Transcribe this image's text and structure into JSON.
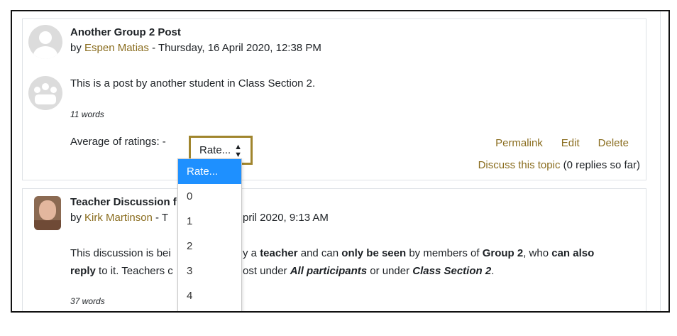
{
  "post1": {
    "title": "Another Group 2 Post",
    "by_prefix": "by ",
    "author": "Espen Matias",
    "date": " - Thursday, 16 April 2020, 12:38 PM",
    "body": "This is a post by another student in Class Section 2.",
    "words": "11 words",
    "avg_label": "Average of ratings: -",
    "rate_selected": "Rate...",
    "actions": [
      "Permalink",
      "Edit",
      "Delete"
    ],
    "discuss_link": "Discuss this topic",
    "discuss_suffix": "(0 replies so far)"
  },
  "dropdown": {
    "options": [
      "Rate...",
      "0",
      "1",
      "2",
      "3",
      "4"
    ],
    "selected_index": 0,
    "highlight_color": "#1e90ff"
  },
  "post2": {
    "title": "Teacher Discussion f",
    "by_prefix": "by ",
    "author": "Kirk Martinson",
    "date_left": " - T",
    "date_right": "pril 2020, 9:13 AM",
    "line1_a": "This discussion is bei",
    "line1_b": "y a ",
    "line1_teacher": "teacher",
    "line1_c": " and can ",
    "line1_only": "only be seen",
    "line1_d": " by members of ",
    "line1_group": "Group 2",
    "line1_e": ", who ",
    "line1_can": "can also",
    "line2_reply": "reply",
    "line2_a": " to it. Teachers c",
    "line2_b": "ost under ",
    "line2_all": "All participants",
    "line2_c": " or under ",
    "line2_section": "Class Section 2",
    "line2_d": ".",
    "words": "37 words"
  },
  "colors": {
    "link": "#8a6d1f",
    "select_border": "#a0852d"
  }
}
